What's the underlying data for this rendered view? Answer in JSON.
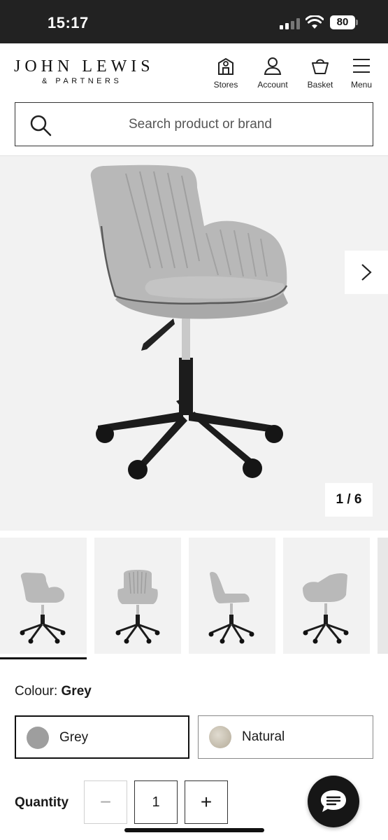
{
  "status_bar": {
    "time": "15:17",
    "battery": "80"
  },
  "header": {
    "logo_main": "JOHN LEWIS",
    "logo_sub": "& PARTNERS",
    "nav": [
      {
        "label": "Stores",
        "icon": "store-icon"
      },
      {
        "label": "Account",
        "icon": "account-icon"
      },
      {
        "label": "Basket",
        "icon": "basket-icon"
      },
      {
        "label": "Menu",
        "icon": "menu-icon"
      }
    ]
  },
  "search": {
    "placeholder": "Search product or brand"
  },
  "gallery": {
    "counter": "1 / 6",
    "thumbnails": [
      "front-angle",
      "front",
      "side",
      "back"
    ],
    "active_thumbnail": 0
  },
  "colour": {
    "label": "Colour:",
    "selected": "Grey",
    "options": [
      {
        "name": "Grey",
        "swatch": "#9e9e9e",
        "selected": true
      },
      {
        "name": "Natural",
        "swatch": "#c9c2b3",
        "selected": false
      }
    ]
  },
  "quantity": {
    "label": "Quantity",
    "value": "1",
    "minus": "−",
    "plus": "+"
  },
  "colors": {
    "header_bg": "#222222",
    "page_bg": "#ffffff",
    "image_bg": "#f2f2f2",
    "chair_fabric": "#b9b9b9",
    "chair_base": "#1c1c1c"
  }
}
